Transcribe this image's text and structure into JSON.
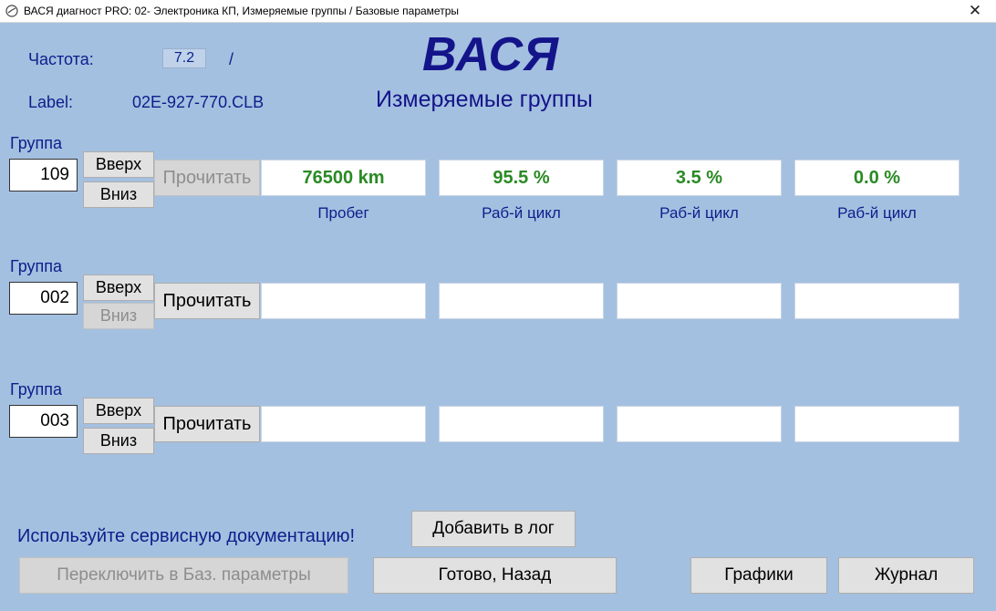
{
  "window": {
    "title": "ВАСЯ диагност PRO: 02- Электроника КП,  Измеряемые группы / Базовые параметры",
    "close_glyph": "✕"
  },
  "header": {
    "freq_label": "Частота:",
    "freq_value": "7.2",
    "freq_sep": "/",
    "label_label": "Label:",
    "label_value": "02E-927-770.CLB",
    "brand": "ВАСЯ",
    "subtitle": "Измеряемые группы"
  },
  "groups": [
    {
      "label": "Группа",
      "number": "109",
      "up": "Вверх",
      "down": "Вниз",
      "read": "Прочитать",
      "values": [
        "76500 km",
        "95.5 %",
        "3.5 %",
        "0.0 %"
      ],
      "units": [
        "Пробег",
        "Раб-й цикл",
        "Раб-й цикл",
        "Раб-й цикл"
      ]
    },
    {
      "label": "Группа",
      "number": "002",
      "up": "Вверх",
      "down": "Вниз",
      "read": "Прочитать",
      "values": [
        "",
        "",
        "",
        ""
      ]
    },
    {
      "label": "Группа",
      "number": "003",
      "up": "Вверх",
      "down": "Вниз",
      "read": "Прочитать",
      "values": [
        "",
        "",
        "",
        ""
      ]
    }
  ],
  "footer": {
    "notice": "Используйте сервисную документацию!",
    "add_log": "Добавить в лог",
    "switch_basic": "Переключить в Баз. параметры",
    "done_back": "Готово, Назад",
    "graphs": "Графики",
    "journal": "Журнал"
  },
  "colors": {
    "background": "#a4c0e0",
    "text_navy": "#0b1f8c",
    "value_green": "#2a8a24"
  },
  "icons": {
    "app": "gauge-icon",
    "close": "close-icon"
  }
}
